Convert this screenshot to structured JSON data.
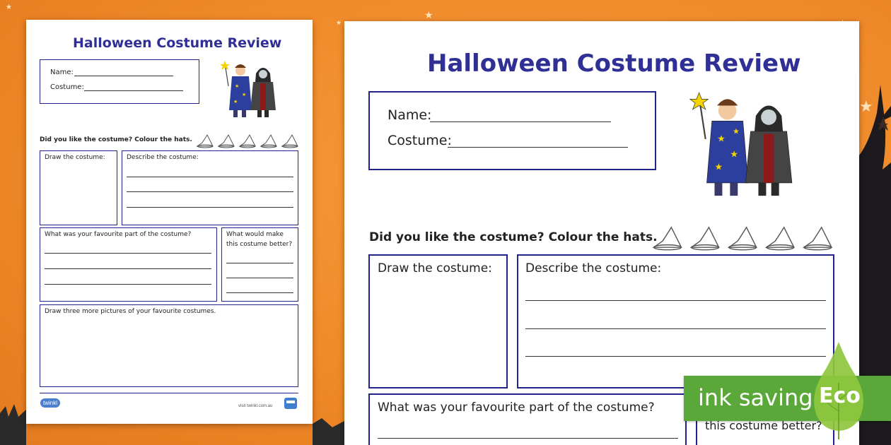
{
  "worksheet": {
    "title": "Halloween Costume Review",
    "name_label": "Name:",
    "costume_label": "Costume:",
    "hats_question": "Did you like the costume? Colour the hats.",
    "draw_label": "Draw the costume:",
    "describe_label": "Describe the costume:",
    "favourite_label": "What was your favourite part of the costume?",
    "better_label_line1": "What would make",
    "better_label_line2": "this costume better?",
    "three_more_label": "Draw three more pictures of your favourite costumes.",
    "footer_logo": "twinkl",
    "footer_url": "visit twinkl.com.au"
  },
  "badge": {
    "text": "ink saving",
    "word": "Eco",
    "color": "#5aa83a"
  },
  "icons": [
    "star-icon",
    "witch-hat-icon",
    "wizard-child-icon",
    "vampire-child-icon",
    "eco-drop-icon"
  ],
  "colors": {
    "background": "#f08a2a",
    "title": "#2f2f96",
    "box_border": "#23238f"
  }
}
